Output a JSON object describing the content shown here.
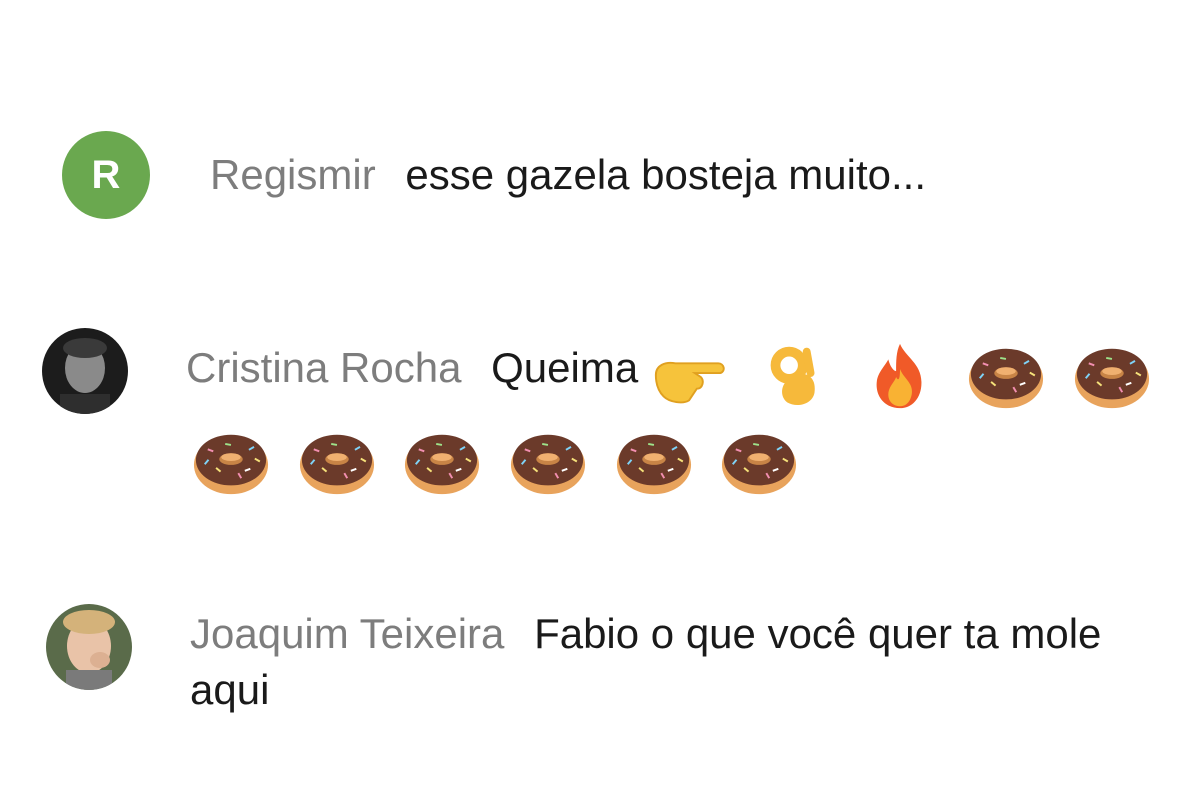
{
  "comments": [
    {
      "author": "Regismir",
      "avatar_letter": "R",
      "avatar_color": "#6aa84f",
      "text": "esse gazela bosteja muito..."
    },
    {
      "author": "Cristina Rocha",
      "text": "Queima",
      "emoji_line1": [
        "pointing-right-emoji",
        "ok-hand-emoji",
        "fire-emoji",
        "doughnut-emoji",
        "doughnut-emoji"
      ],
      "emoji_line2": [
        "doughnut-emoji",
        "doughnut-emoji",
        "doughnut-emoji",
        "doughnut-emoji",
        "doughnut-emoji",
        "doughnut-emoji"
      ]
    },
    {
      "author": "Joaquim Teixeira",
      "text_line1": "Fabio o que você quer ta mole",
      "text_line2": "aqui"
    }
  ]
}
